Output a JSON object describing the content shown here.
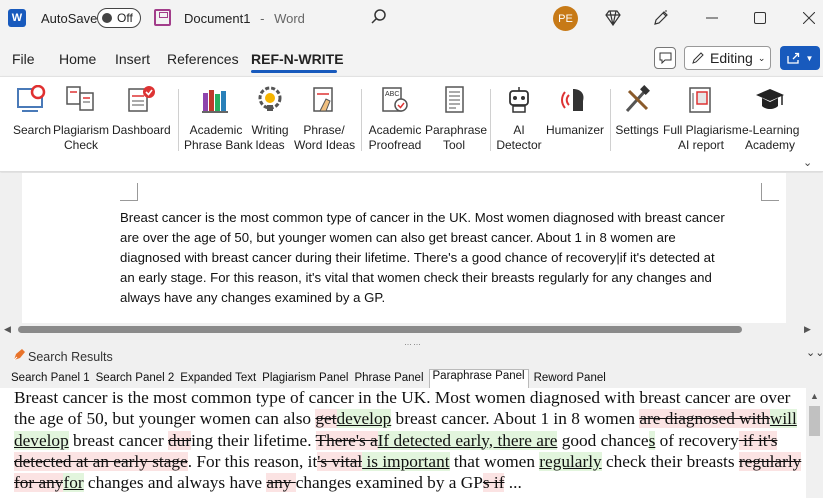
{
  "titlebar": {
    "app_logo": "W",
    "autosave_label": "AutoSave",
    "autosave_state": "Off",
    "document_name": "Document1",
    "separator": "-",
    "app_name": "Word",
    "avatar_initials": "PE"
  },
  "menu": {
    "items": [
      "File",
      "Home",
      "Insert",
      "References",
      "REF-N-WRITE"
    ],
    "active": "REF-N-WRITE",
    "editing_label": "Editing"
  },
  "ribbon": {
    "buttons": [
      {
        "line1": "Search",
        "line2": "",
        "icon": "search-screen-icon"
      },
      {
        "line1": "Plagiarism",
        "line2": "Check",
        "icon": "plagiarism-doc-icon"
      },
      {
        "line1": "Dashboard",
        "line2": "",
        "icon": "dashboard-icon"
      },
      {
        "line1": "Academic",
        "line2": "Phrase Bank",
        "icon": "books-icon"
      },
      {
        "line1": "Writing",
        "line2": "Ideas",
        "icon": "lightbulb-gear-icon"
      },
      {
        "line1": "Phrase/",
        "line2": "Word Ideas",
        "icon": "hand-doc-icon"
      },
      {
        "line1": "Academic",
        "line2": "Proofread",
        "icon": "abc-check-icon"
      },
      {
        "line1": "Paraphrase",
        "line2": "Tool",
        "icon": "paraphrase-doc-icon"
      },
      {
        "line1": "AI",
        "line2": "Detector",
        "icon": "robot-icon"
      },
      {
        "line1": "Humanizer",
        "line2": "",
        "icon": "humanizer-head-icon"
      },
      {
        "line1": "Settings",
        "line2": "",
        "icon": "tools-icon"
      },
      {
        "line1": "Full Plagiarism",
        "line2": "AI report",
        "icon": "report-icon"
      },
      {
        "line1": "e-Learning",
        "line2": "Academy",
        "icon": "graduation-cap-icon"
      }
    ]
  },
  "document": {
    "lines": [
      "Breast cancer is the most common type of cancer in the UK. Most women diagnosed with breast cancer",
      "are over the age of 50, but younger women can also get breast cancer. About 1 in 8 women are",
      "diagnosed with breast cancer during their lifetime. There's a good chance of recovery|if it's detected at",
      "an early stage. For this reason, it's vital that women check their breasts regularly for any changes and",
      "always have any changes examined by a GP."
    ]
  },
  "panel": {
    "title": "Search Results",
    "tabs": [
      "Search Panel 1",
      "Search Panel 2",
      "Expanded Text",
      "Plagiarism Panel",
      "Phrase Panel",
      "Paraphrase Panel",
      "Reword Panel"
    ],
    "active_tab": "Paraphrase Panel",
    "segments": [
      {
        "t": "n",
        "s": "Breast cancer is the most common type of cancer in the UK. Most women diagnosed with breast cancer are over the age of 50, but younger women can also "
      },
      {
        "t": "d",
        "s": "get"
      },
      {
        "t": "i",
        "s": "develop"
      },
      {
        "t": "n",
        "s": " breast cancer. About 1 in 8 women "
      },
      {
        "t": "d",
        "s": "are diagnosed with"
      },
      {
        "t": "i",
        "s": "will develop"
      },
      {
        "t": "n",
        "s": " breast cancer "
      },
      {
        "t": "d",
        "s": "dur"
      },
      {
        "t": "n",
        "s": "ing their lifetime. "
      },
      {
        "t": "d",
        "s": "There's a"
      },
      {
        "t": "i",
        "s": "If detected early, there are"
      },
      {
        "t": "n",
        "s": " good chance"
      },
      {
        "t": "i",
        "s": "s"
      },
      {
        "t": "n",
        "s": " of recovery"
      },
      {
        "t": "d",
        "s": " if it's detected at an early stage"
      },
      {
        "t": "n",
        "s": ". For this reason, it"
      },
      {
        "t": "d",
        "s": "'s vital"
      },
      {
        "t": "i",
        "s": " is important"
      },
      {
        "t": "n",
        "s": " that women "
      },
      {
        "t": "i",
        "s": "regularly"
      },
      {
        "t": "n",
        "s": " check their breasts "
      },
      {
        "t": "d",
        "s": "regularly for any"
      },
      {
        "t": "i",
        "s": "for"
      },
      {
        "t": "n",
        "s": " changes and always have "
      },
      {
        "t": "d",
        "s": "any "
      },
      {
        "t": "n",
        "s": "changes examined by a GP"
      },
      {
        "t": "d",
        "s": "s if"
      },
      {
        "t": "n",
        "s": " ..."
      }
    ]
  }
}
